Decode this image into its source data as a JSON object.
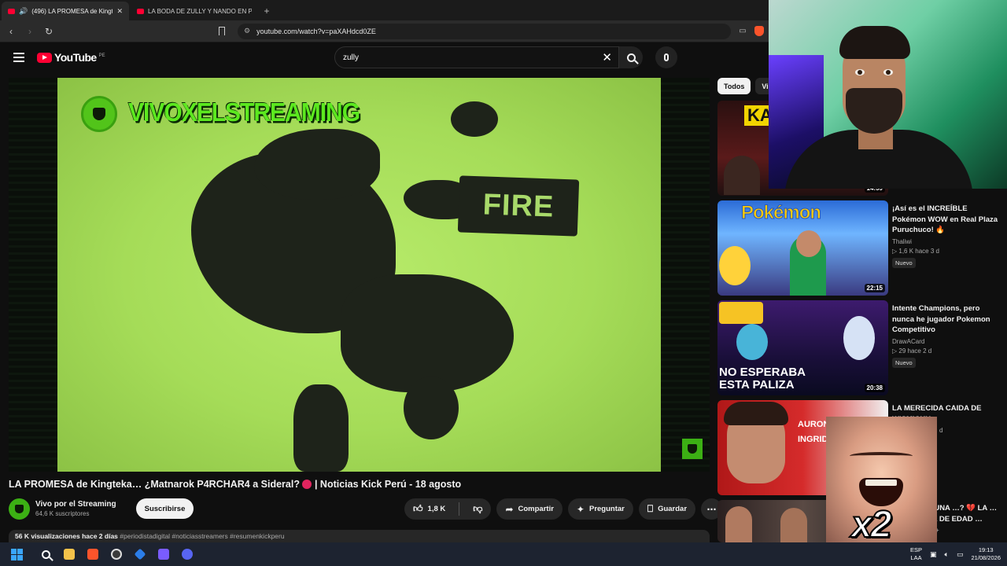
{
  "browser": {
    "tabs": [
      {
        "title": "(496) LA PROMESA de Kingteka",
        "active": true
      },
      {
        "title": "LA BODA DE ZULLY Y NANDO EN PE",
        "active": false
      }
    ],
    "url": "youtube.com/watch?v=paXAHdcd0ZE"
  },
  "header": {
    "logo_text": "YouTube",
    "region": "PE",
    "search_value": "zully"
  },
  "player": {
    "overlay_channel_text": "VIVOXELSTREAMING",
    "overlay_badge_text": "FIRE"
  },
  "video": {
    "title_part1": "LA PROMESA de Kingteka… ¿Matnarok P4RCHAR4 a Sideral?",
    "title_part2": "| Noticias Kick Perú - 18 agosto",
    "channel": "Vivo por el Streaming",
    "subscribers": "64,6 K suscriptores",
    "subscribe_label": "Suscribirse",
    "likes": "1,8 K",
    "share_label": "Compartir",
    "ask_label": "Preguntar",
    "save_label": "Guardar",
    "views": "56 K visualizaciones",
    "age": "hace 2 días",
    "tags": "#periodistadigital #noticiasstreamers #resumenkickperu"
  },
  "sidebar": {
    "chips": [
      "Todos",
      "Vi"
    ],
    "recommendations": [
      {
        "title": "",
        "channel": "",
        "stats": "",
        "duration": "14:59",
        "badge": "",
        "thumb_text": "KAG"
      },
      {
        "title": "¡Así es el INCREÍBLE Pokémon WOW en Real Plaza Puruchuco! 🔥",
        "channel": "Thaliwi",
        "stats": "▷ 1,6 K   hace 3 d",
        "duration": "22:15",
        "badge": "Nuevo",
        "thumb_text": "Pokémon"
      },
      {
        "title": "Intente Champions, pero nunca he jugador Pokemon Competitivo",
        "channel": "DrawACard",
        "stats": "▷ 29   hace 2 d",
        "duration": "20:38",
        "badge": "Nuevo",
        "thumb_text": "NO ESPERABA ESTA PALIZA"
      },
      {
        "title": "LA MERECIDA CAIDA DE WISMICHU",
        "channel": "",
        "stats": "d",
        "duration": "",
        "badge": "",
        "thumb_text": "AURONP DALAS: INGRID: MIARE:"
      },
      {
        "title": "…AS UNA …? 💔 LA …ENCIA DE EDAD …",
        "channel": "…DITO+",
        "stats": "",
        "duration": "",
        "badge": "",
        "thumb_text": ""
      }
    ]
  },
  "meme": {
    "text": "x2"
  },
  "taskbar": {
    "lang_top": "ESP",
    "lang_bottom": "LAA",
    "time": "19:13",
    "date": "21/08/2026"
  },
  "colors": {
    "yt_red": "#ff0033",
    "bg": "#0f0f0f",
    "neon_green": "#5ce81f"
  }
}
